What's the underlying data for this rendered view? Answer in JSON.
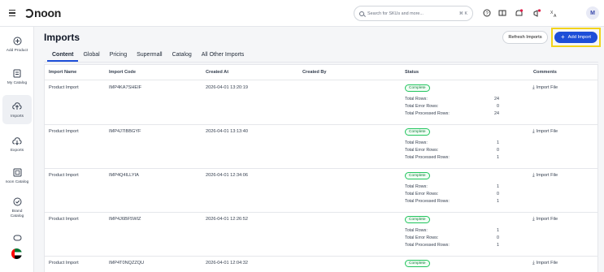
{
  "topbar": {
    "logo_text": "noon",
    "search_placeholder": "Search for SKUs and more...",
    "search_shortcut": "⌘ K",
    "avatar_initial": "M"
  },
  "sidebar": {
    "items": [
      {
        "label": "Add Product",
        "icon": "plus-circle-icon"
      },
      {
        "label": "My Catalog",
        "icon": "catalog-icon"
      },
      {
        "label": "Imports",
        "icon": "cloud-upload-icon"
      },
      {
        "label": "Exports",
        "icon": "cloud-download-icon"
      },
      {
        "label": "noon Catalog",
        "icon": "noon-catalog-icon"
      },
      {
        "label": "Brand Catalog",
        "icon": "brand-catalog-icon"
      }
    ]
  },
  "page": {
    "title": "Imports",
    "refresh_label": "Refresh Imports",
    "add_label": "Add Import"
  },
  "tabs": [
    "Content",
    "Global",
    "Pricing",
    "Supermall",
    "Catalog",
    "All Other Imports"
  ],
  "table": {
    "headers": [
      "Import Name",
      "Import Code",
      "Created At",
      "Created By",
      "Status",
      "Comments"
    ],
    "stat_labels": [
      "Total Rows:",
      "Total Error Rows:",
      "Total Processed Rows:"
    ],
    "action_label": "Import File",
    "rows": [
      {
        "name": "Product Import",
        "code": "IMP4KA7SHEIF",
        "created_at": "2026-04-01 13:20:19",
        "status": "Complete",
        "total": "24",
        "errors": "0",
        "processed": "24"
      },
      {
        "name": "Product Import",
        "code": "IMP4J7IBBGYF",
        "created_at": "2026-04-01 13:13:40",
        "status": "Complete",
        "total": "1",
        "errors": "0",
        "processed": "1"
      },
      {
        "name": "Product Import",
        "code": "IMP4Q4ILLYIA",
        "created_at": "2026-04-01 12:34:06",
        "status": "Complete",
        "total": "1",
        "errors": "0",
        "processed": "1"
      },
      {
        "name": "Product Import",
        "code": "IMP4J6BF5WIZ",
        "created_at": "2026-04-01 12:26:52",
        "status": "Complete",
        "total": "1",
        "errors": "0",
        "processed": "1"
      },
      {
        "name": "Product Import",
        "code": "IMP4T0NQZZQU",
        "created_at": "2026-04-01 12:04:32",
        "status": "Complete"
      }
    ]
  }
}
